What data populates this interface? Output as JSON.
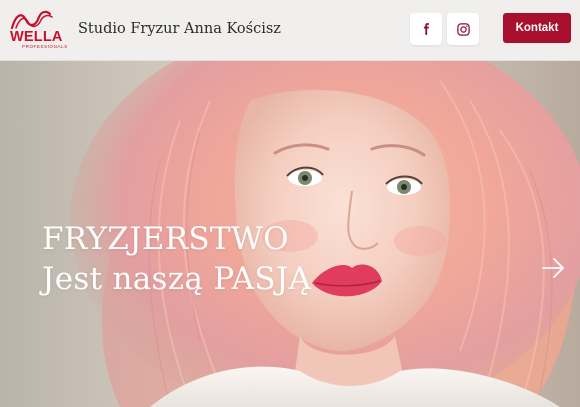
{
  "header": {
    "logo": {
      "brand": "WELLA",
      "subtitle": "PROFESSIONALS",
      "icon": "wella-wave-logo"
    },
    "site_title": "Studio Fryzur Anna Kościsz",
    "social": [
      {
        "name": "Facebook",
        "icon": "facebook-icon"
      },
      {
        "name": "Instagram",
        "icon": "instagram-icon"
      }
    ],
    "contact_label": "Kontakt",
    "colors": {
      "accent": "#a8102d",
      "brand_red": "#c8102e",
      "header_bg": "#f0efed"
    }
  },
  "hero": {
    "line1": "FRYZJERSTWO",
    "line2": "Jest naszą PASJĄ",
    "next_icon": "chevron-right-icon",
    "image": "woman-with-pink-hair-photo"
  }
}
